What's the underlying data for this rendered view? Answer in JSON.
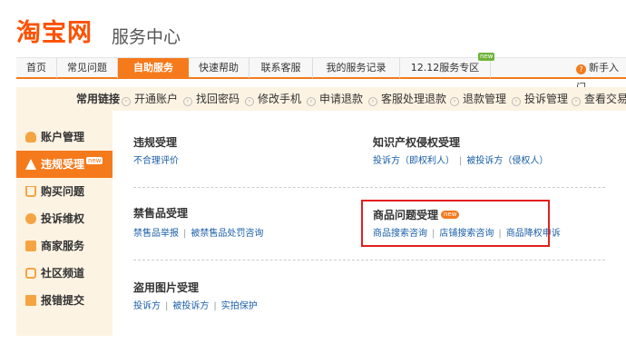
{
  "header": {
    "logo": "淘宝网",
    "subtitle": "服务中心"
  },
  "nav": {
    "items": [
      "首页",
      "常见问题",
      "自助服务",
      "快速帮助",
      "联系客服",
      "我的服务记录",
      "12.12服务专区"
    ],
    "active_index": 2,
    "new_badge": "new",
    "guide": "新手入门",
    "guide_icon": "?"
  },
  "quick_links": {
    "title": "常用链接",
    "items": [
      "开通账户",
      "找回密码",
      "修改手机",
      "申请退款",
      "客服处理退款",
      "退款管理",
      "投诉管理",
      "查看交易"
    ]
  },
  "sidebar": {
    "items": [
      "账户管理",
      "违规受理",
      "购买问题",
      "投诉维权",
      "商家服务",
      "社区频道",
      "报错提交"
    ],
    "active_index": 1,
    "new_badge": "new"
  },
  "sections": {
    "violation": {
      "title": "违规受理",
      "links": [
        "不合理评价"
      ]
    },
    "ip": {
      "title": "知识产权侵权受理",
      "links": [
        "投诉方（即权利人）",
        "被投诉方（侵权人）"
      ]
    },
    "banned": {
      "title": "禁售品受理",
      "links": [
        "禁售品举报",
        "被禁售品处罚咨询"
      ]
    },
    "product": {
      "title": "商品问题受理",
      "new_badge": "new",
      "links": [
        "商品搜索咨询",
        "店铺搜索咨询",
        "商品降权申诉"
      ]
    },
    "image": {
      "title": "盗用图片受理",
      "links": [
        "投诉方",
        "被投诉方",
        "实拍保护"
      ]
    }
  },
  "colors": {
    "accent": "#f57a1c",
    "logo": "#ff5000",
    "link": "#1a5ea8",
    "highlight": "#e02020",
    "panel_bg": "#fdf3e3"
  }
}
